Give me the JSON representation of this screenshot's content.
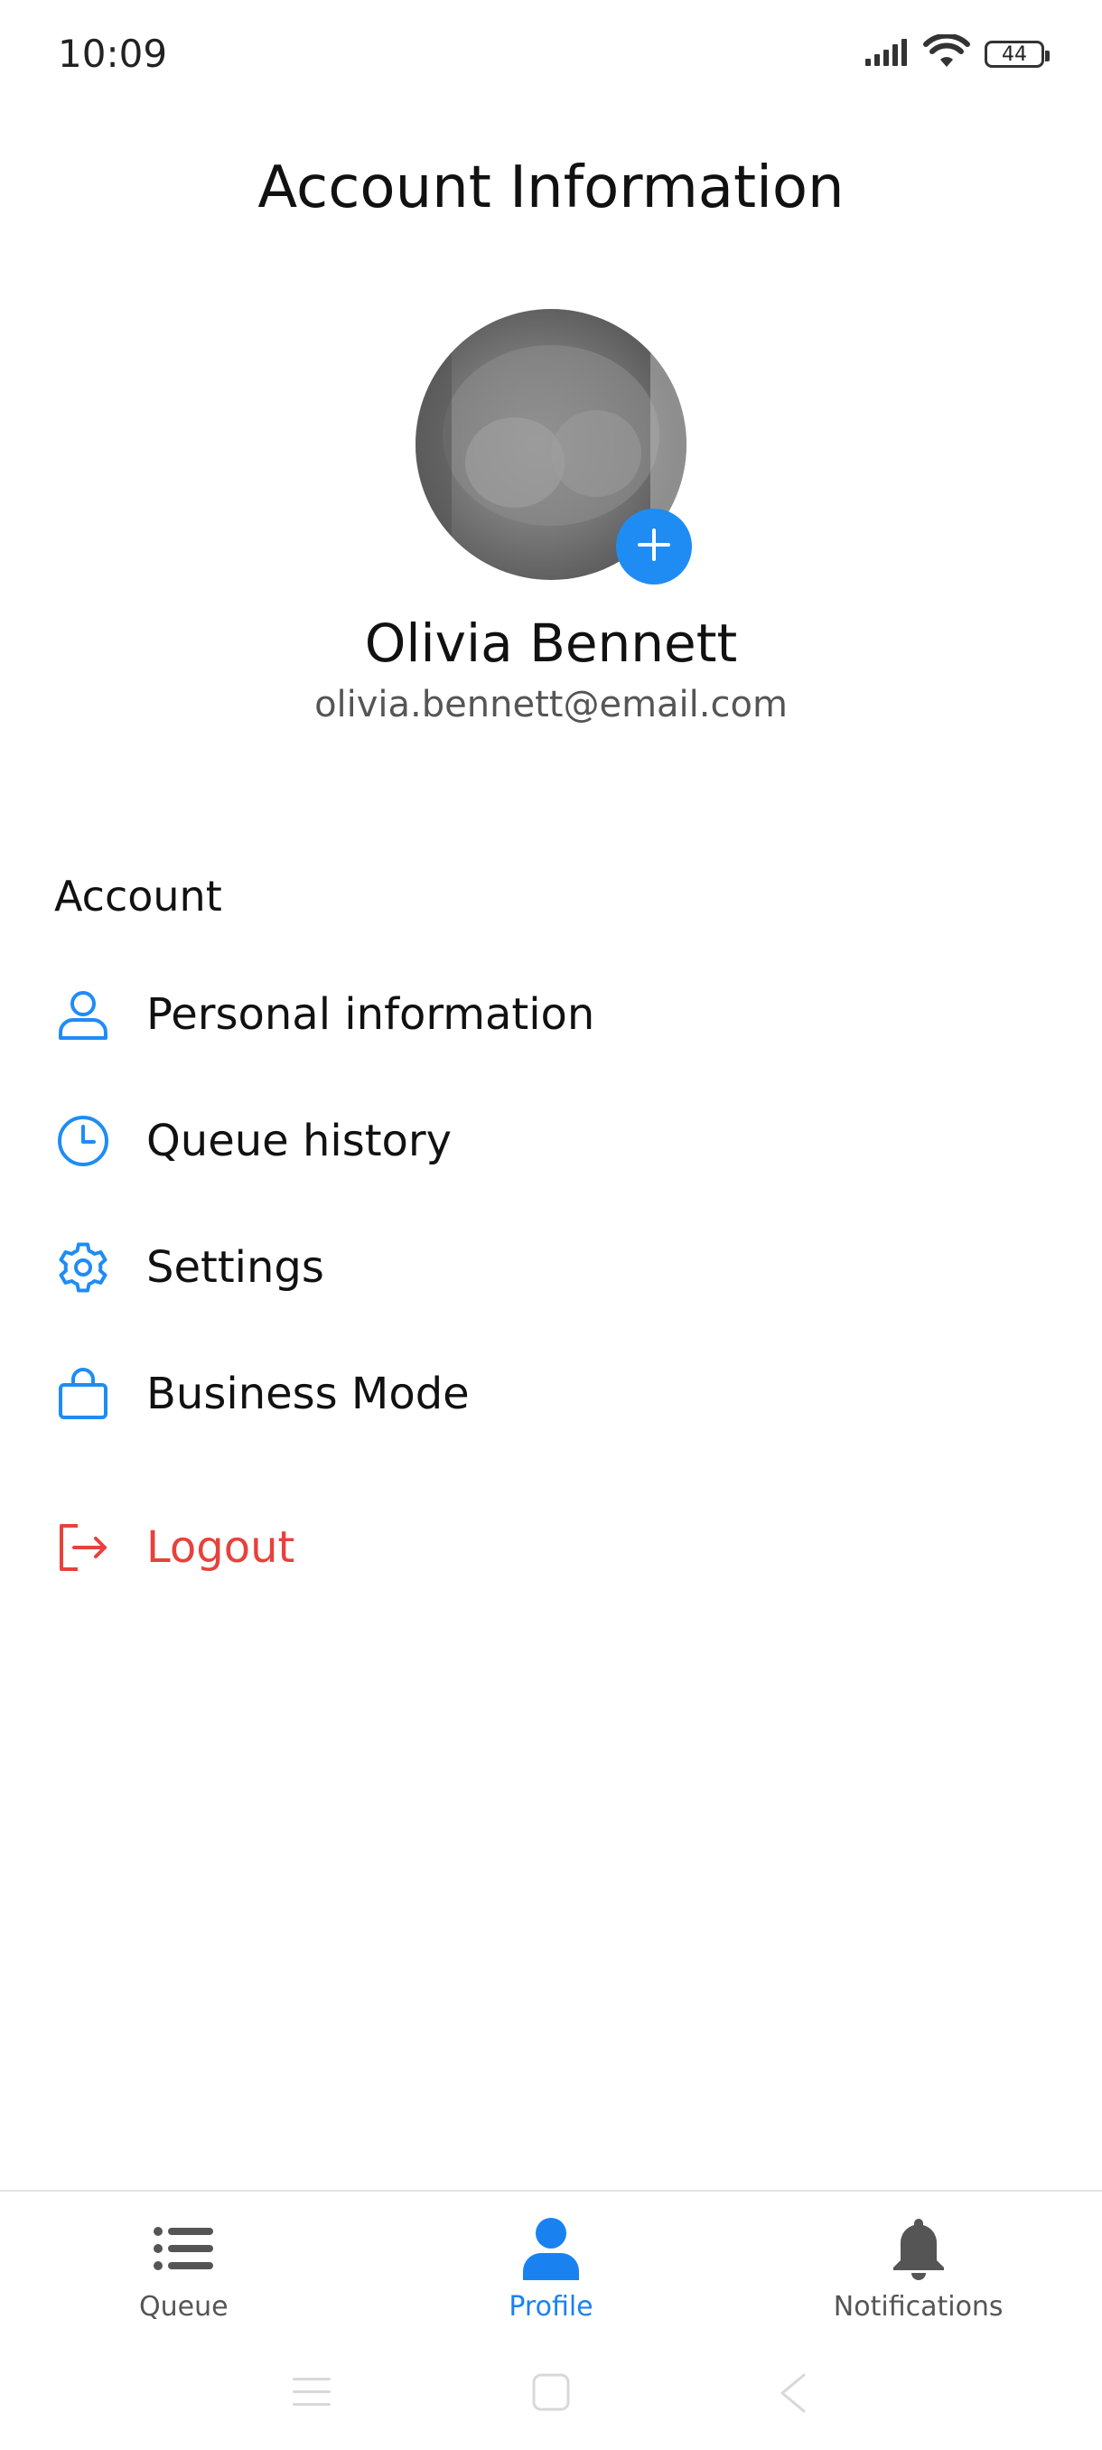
{
  "status_bar": {
    "time": "10:09",
    "battery": "44",
    "icons": [
      "signal-icon",
      "wifi-icon",
      "battery-icon"
    ]
  },
  "page": {
    "title": "Account Information"
  },
  "profile": {
    "name": "Olivia Bennett",
    "email": "olivia.bennett@email.com",
    "avatar_add_icon": "plus-icon"
  },
  "account_section": {
    "heading": "Account",
    "items": [
      {
        "label": "Personal information",
        "icon": "person-icon"
      },
      {
        "label": "Queue history",
        "icon": "clock-icon"
      },
      {
        "label": "Settings",
        "icon": "gear-icon"
      },
      {
        "label": "Business Mode",
        "icon": "bag-icon"
      }
    ],
    "logout": {
      "label": "Logout",
      "icon": "logout-icon"
    }
  },
  "bottom_nav": {
    "items": [
      {
        "label": "Queue",
        "icon": "list-icon",
        "active": false
      },
      {
        "label": "Profile",
        "icon": "person-filled-icon",
        "active": true
      },
      {
        "label": "Notifications",
        "icon": "bell-icon",
        "active": false
      }
    ]
  },
  "colors": {
    "accent": "#1a82f0",
    "danger": "#e8413b",
    "text": "#111111",
    "muted": "#555555"
  }
}
